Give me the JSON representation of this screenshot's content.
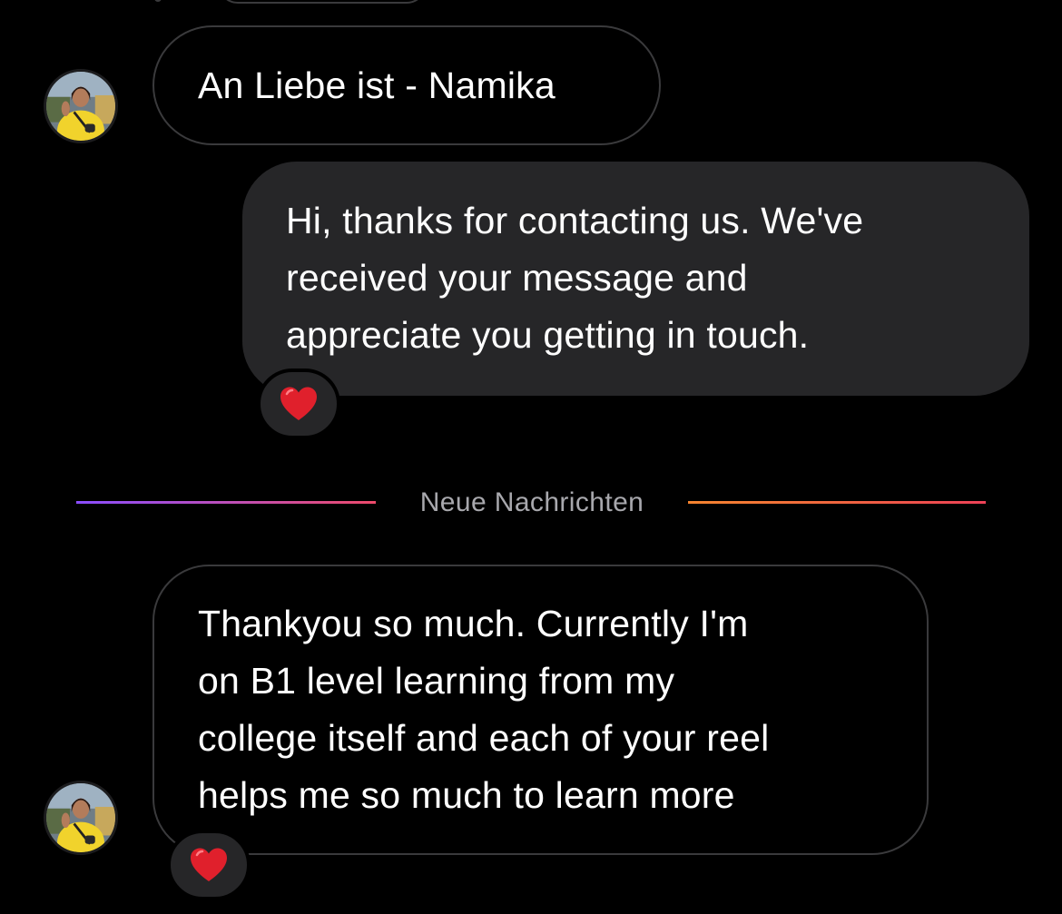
{
  "conversation": {
    "messages": [
      {
        "direction": "incoming",
        "lines": [
          "An Liebe ist - Namika"
        ]
      },
      {
        "direction": "outgoing",
        "lines": [
          "Hi, thanks for contacting us. We've",
          "received your message and",
          "appreciate you getting in touch."
        ],
        "reaction": "red-heart"
      },
      {
        "direction": "incoming",
        "lines": [
          "Thankyou so much. Currently I'm",
          "on B1 level learning from my",
          "college itself and each of your reel",
          "helps me so much to learn more"
        ],
        "reaction": "red-heart"
      }
    ],
    "divider": {
      "label": "Neue Nachrichten"
    }
  },
  "colors": {
    "background": "#000000",
    "incoming_border": "#3a3a3c",
    "outgoing_bubble": "#262628",
    "text": "#ffffff",
    "divider_text": "#a8a8ad",
    "reaction_heart": "#e0202c"
  },
  "icons": {
    "reaction": "heart-icon",
    "avatar": "user-avatar"
  }
}
